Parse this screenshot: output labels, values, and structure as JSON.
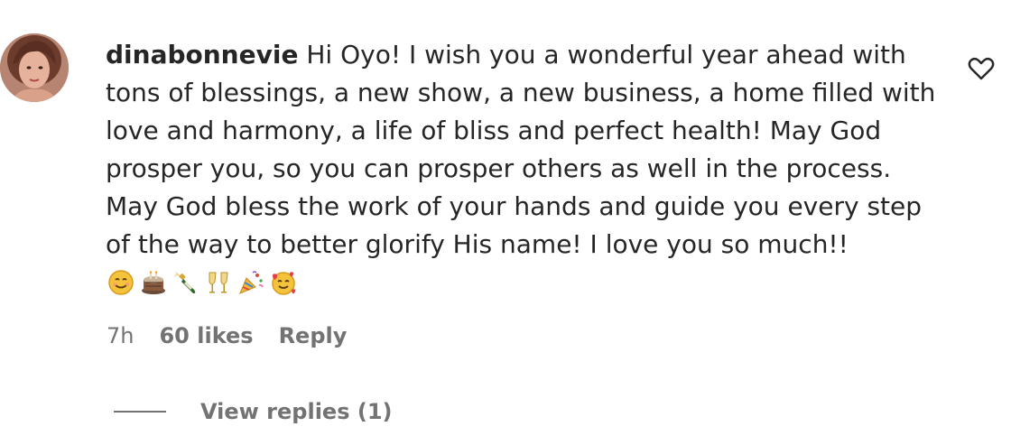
{
  "comment": {
    "username": "dinabonnevie",
    "text": "Hi Oyo! I wish you a wonderful year ahead with tons of blessings, a new show, a new business, a home filled with love and harmony, a life of bliss and perfect health! May God prosper you, so you can prosper others as well in the process. May God bless the work of your hands and guide you every step of the way to better glorify His name! I love you so much!!",
    "emojis": [
      "smiling-face-icon",
      "cake-icon",
      "champagne-bottle-icon",
      "clinking-glasses-icon",
      "party-popper-icon",
      "smiling-face-with-hearts-icon"
    ],
    "time": "7h",
    "likes": "60 likes",
    "reply_label": "Reply",
    "view_replies_label": "View replies (1)"
  }
}
